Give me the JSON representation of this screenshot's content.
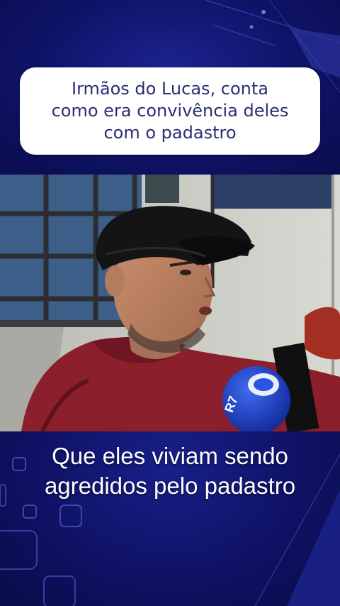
{
  "headline": {
    "line1": "Irmãos do Lucas, conta",
    "line2": "como era convivência deles",
    "line3": "com o padastro"
  },
  "caption": {
    "line1": "Que eles viviam sendo",
    "line2": "agredidos pelo padastro"
  },
  "microphone": {
    "logo_text": "R7"
  },
  "colors": {
    "background": "#0e1160",
    "headline_text": "#2a2f73",
    "caption_text": "#ffffff",
    "hoodie": "#8c1f2c",
    "microphone": "#1a3fc9"
  }
}
